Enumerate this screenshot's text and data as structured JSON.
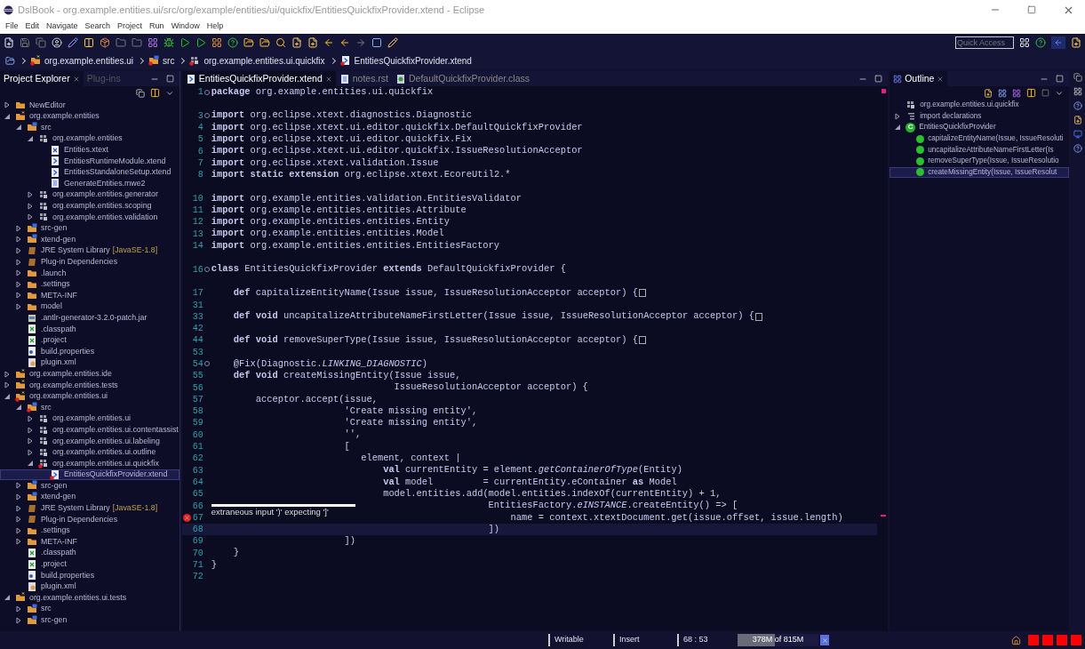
{
  "window": {
    "title": "DslBook - org.example.entities.ui/src/org/example/entities/ui/quickfix/EntitiesQuickfixProvider.xtend - Eclipse"
  },
  "menu": [
    "File",
    "Edit",
    "Navigate",
    "Search",
    "Project",
    "Run",
    "Window",
    "Help"
  ],
  "quick_access": {
    "placeholder": "Quick Access"
  },
  "breadcrumb": [
    {
      "label": "org.example.entities.ui",
      "kind": "project"
    },
    {
      "label": "src",
      "kind": "source-folder"
    },
    {
      "label": "org.example.entities.ui.quickfix",
      "kind": "package"
    },
    {
      "label": "EntitiesQuickfixProvider.xtend",
      "kind": "xtend-file"
    }
  ],
  "left_panel": {
    "tabs": [
      {
        "label": "Project Explorer",
        "selected": true
      },
      {
        "label": "Plug-ins",
        "selected": false
      }
    ],
    "tree": [
      {
        "label": "NewEditor",
        "kind": "folder",
        "expanded": false,
        "selected": false
      },
      {
        "label": "org.example.entities",
        "kind": "project",
        "expanded": true,
        "selected": false,
        "children": [
          {
            "label": "src",
            "kind": "source-folder",
            "expanded": true,
            "selected": false,
            "children": [
              {
                "label": "org.example.entities",
                "kind": "package",
                "expanded": true,
                "selected": false,
                "children": [
                  {
                    "label": "Entities.xtext",
                    "kind": "xtext-file",
                    "selected": false
                  },
                  {
                    "label": "EntitiesRuntimeModule.xtend",
                    "kind": "xtend-file",
                    "selected": false
                  },
                  {
                    "label": "EntitiesStandaloneSetup.xtend",
                    "kind": "xtend-file",
                    "selected": false
                  },
                  {
                    "label": "GenerateEntities.mwe2",
                    "kind": "text-file",
                    "selected": false
                  }
                ]
              },
              {
                "label": "org.example.entities.generator",
                "kind": "package",
                "expanded": false,
                "selected": false
              },
              {
                "label": "org.example.entities.scoping",
                "kind": "package",
                "expanded": false,
                "selected": false
              },
              {
                "label": "org.example.entities.validation",
                "kind": "package",
                "expanded": false,
                "selected": false
              }
            ]
          },
          {
            "label": "src-gen",
            "kind": "source-folder",
            "expanded": false,
            "selected": false
          },
          {
            "label": "xtend-gen",
            "kind": "source-folder",
            "expanded": false,
            "selected": false
          },
          {
            "label": "JRE System Library",
            "decoration": "[JavaSE-1.8]",
            "kind": "library",
            "expanded": false,
            "selected": false
          },
          {
            "label": "Plug-in Dependencies",
            "kind": "library",
            "expanded": false,
            "selected": false
          },
          {
            "label": ".launch",
            "kind": "folder",
            "expanded": false,
            "selected": false
          },
          {
            "label": ".settings",
            "kind": "folder",
            "expanded": false,
            "selected": false
          },
          {
            "label": "META-INF",
            "kind": "folder",
            "expanded": false,
            "selected": false
          },
          {
            "label": "model",
            "kind": "folder",
            "expanded": false,
            "selected": false
          },
          {
            "label": ".antlr-generator-3.2.0-patch.jar",
            "kind": "jar",
            "selected": false
          },
          {
            "label": ".classpath",
            "kind": "xml-file",
            "selected": false
          },
          {
            "label": ".project",
            "kind": "xml-file",
            "selected": false
          },
          {
            "label": "build.properties",
            "kind": "properties-file",
            "selected": false
          },
          {
            "label": "plugin.xml",
            "kind": "plugin-file",
            "selected": false
          }
        ]
      },
      {
        "label": "org.example.entities.ide",
        "kind": "project",
        "expanded": false,
        "selected": false
      },
      {
        "label": "org.example.entities.tests",
        "kind": "project",
        "expanded": false,
        "selected": false
      },
      {
        "label": "org.example.entities.ui",
        "kind": "project",
        "error": true,
        "expanded": true,
        "selected": false,
        "children": [
          {
            "label": "src",
            "kind": "source-folder",
            "error": true,
            "expanded": true,
            "selected": false,
            "children": [
              {
                "label": "org.example.entities.ui",
                "kind": "package",
                "expanded": false,
                "selected": false
              },
              {
                "label": "org.example.entities.ui.contentassist",
                "kind": "package",
                "expanded": false,
                "selected": false
              },
              {
                "label": "org.example.entities.ui.labeling",
                "kind": "package",
                "expanded": false,
                "selected": false
              },
              {
                "label": "org.example.entities.ui.outline",
                "kind": "package",
                "expanded": false,
                "selected": false
              },
              {
                "label": "org.example.entities.ui.quickfix",
                "kind": "package",
                "error": true,
                "expanded": true,
                "selected": false,
                "children": [
                  {
                    "label": "EntitiesQuickfixProvider.xtend",
                    "kind": "xtend-file",
                    "error": true,
                    "selected": true
                  }
                ]
              }
            ]
          },
          {
            "label": "src-gen",
            "kind": "source-folder",
            "expanded": false,
            "selected": false
          },
          {
            "label": "xtend-gen",
            "kind": "source-folder",
            "expanded": false,
            "selected": false
          },
          {
            "label": "JRE System Library",
            "decoration": "[JavaSE-1.8]",
            "kind": "library",
            "expanded": false,
            "selected": false
          },
          {
            "label": "Plug-in Dependencies",
            "kind": "library",
            "expanded": false,
            "selected": false
          },
          {
            "label": ".settings",
            "kind": "folder",
            "expanded": false,
            "selected": false
          },
          {
            "label": "META-INF",
            "kind": "folder",
            "expanded": false,
            "selected": false
          },
          {
            "label": ".classpath",
            "kind": "xml-file",
            "selected": false
          },
          {
            "label": ".project",
            "kind": "xml-file",
            "selected": false
          },
          {
            "label": "build.properties",
            "kind": "properties-file",
            "selected": false
          },
          {
            "label": "plugin.xml",
            "kind": "plugin-file",
            "selected": false
          }
        ]
      },
      {
        "label": "org.example.entities.ui.tests",
        "kind": "project",
        "expanded": true,
        "selected": false,
        "children": [
          {
            "label": "src",
            "kind": "source-folder",
            "expanded": false,
            "selected": false
          },
          {
            "label": "src-gen",
            "kind": "source-folder",
            "expanded": false,
            "selected": false
          }
        ]
      }
    ]
  },
  "editor": {
    "tabs": [
      {
        "label": "EntitiesQuickfixProvider.xtend",
        "kind": "xtend-file",
        "selected": true
      },
      {
        "label": "notes.rst",
        "kind": "text-file",
        "selected": false
      },
      {
        "label": "DefaultQuickfixProvider.class",
        "kind": "class-file",
        "selected": false
      }
    ],
    "lines": [
      {
        "number": "1",
        "text": "**package** org.example.entities.ui.quickfix",
        "fold_toggle": true,
        "current": false
      },
      {
        "current": false
      },
      {
        "number": "3",
        "text": "**import** org.eclipse.xtext.diagnostics.Diagnostic",
        "fold_toggle": true,
        "current": false
      },
      {
        "number": "4",
        "text": "**import** org.eclipse.xtext.ui.editor.quickfix.DefaultQuickfixProvider",
        "current": false
      },
      {
        "number": "5",
        "text": "**import** org.eclipse.xtext.ui.editor.quickfix.Fix",
        "current": false
      },
      {
        "number": "6",
        "text": "**import** org.eclipse.xtext.ui.editor.quickfix.IssueResolutionAcceptor",
        "current": false
      },
      {
        "number": "7",
        "text": "**import** org.eclipse.xtext.validation.Issue",
        "current": false
      },
      {
        "number": "8",
        "text": "**import** **static** **extension** org.eclipse.xtext.EcoreUtil2.*",
        "current": false
      },
      {
        "current": false
      },
      {
        "number": "10",
        "text": "**import** org.example.entities.validation.EntitiesValidator",
        "current": false
      },
      {
        "number": "11",
        "text": "**import** org.example.entities.entities.Attribute",
        "current": false
      },
      {
        "number": "12",
        "text": "**import** org.example.entities.entities.Entity",
        "current": false
      },
      {
        "number": "13",
        "text": "**import** org.example.entities.entities.Model",
        "current": false
      },
      {
        "number": "14",
        "text": "**import** org.example.entities.entities.EntitiesFactory",
        "current": false
      },
      {
        "current": false
      },
      {
        "number": "16",
        "text": "**class** EntitiesQuickfixProvider **extends** DefaultQuickfixProvider {",
        "fold_toggle": true,
        "current": false
      },
      {
        "current": false
      },
      {
        "number": "17",
        "text": "    **def** capitalizeEntityName(Issue issue, IssueResolutionAcceptor acceptor) {",
        "collapsed": true,
        "current": false
      },
      {
        "number": "31",
        "current": false
      },
      {
        "number": "33",
        "text": "    **def** **void** uncapitalizeAttributeNameFirstLetter(Issue issue, IssueResolutionAcceptor acceptor) {",
        "collapsed": true,
        "current": false
      },
      {
        "number": "42",
        "current": false
      },
      {
        "number": "44",
        "text": "    **def** **void** removeSuperType(Issue issue, IssueResolutionAcceptor acceptor) {",
        "collapsed": true,
        "current": false
      },
      {
        "number": "53",
        "current": false
      },
      {
        "number": "54",
        "text": "    @Fix(Diagnostic.*LINKING_DIAGNOSTIC*)",
        "fold_toggle": true,
        "current": false
      },
      {
        "number": "55",
        "text": "    **def** **void** createMissingEntity(Issue issue,",
        "current": false
      },
      {
        "number": "56",
        "text": "                                 IssueResolutionAcceptor acceptor) {",
        "current": false
      },
      {
        "number": "57",
        "text": "        acceptor.accept(issue,",
        "current": false
      },
      {
        "number": "58",
        "text": "                        'Create missing entity',",
        "current": false
      },
      {
        "number": "59",
        "text": "                        'Create missing entity',",
        "current": false
      },
      {
        "number": "60",
        "text": "                        '',",
        "current": false
      },
      {
        "number": "61",
        "text": "                        [",
        "current": false
      },
      {
        "number": "62",
        "text": "                           element, context |",
        "current": false
      },
      {
        "number": "63",
        "text": "                               **val** currentEntity = element.*getContainerOfType*(Entity)",
        "current": false
      },
      {
        "number": "64",
        "text": "                               **val** model         = currentEntity.eContainer **as** Model",
        "current": false
      },
      {
        "number": "65",
        "text": "                               model.entities.add(model.entities.indexOf(currentEntity) + 1,",
        "current": false
      },
      {
        "number": "66",
        "text": "                                                  EntitiesFactory.*eINSTANCE*.createEntity() => [",
        "current": false
      },
      {
        "number": "67",
        "text": "                                                      name = context.xtextDocument.get(issue.offset, issue.length)",
        "error": true,
        "current": false
      },
      {
        "number": "68",
        "text": "                                                  ])",
        "current": true
      },
      {
        "number": "69",
        "text": "                        ])",
        "current": false
      },
      {
        "number": "70",
        "text": "    }",
        "current": false
      },
      {
        "number": "71",
        "text": "}",
        "current": false
      },
      {
        "number": "72",
        "current": false
      }
    ],
    "error_tooltip": "extraneous input ')' expecting ']'"
  },
  "outline": {
    "tab": "Outline",
    "tree": [
      {
        "label": "org.example.entities.ui.quickfix",
        "kind": "package",
        "selected": false
      },
      {
        "label": "import declarations",
        "kind": "imports",
        "expanded": false,
        "selected": false
      },
      {
        "label": "EntitiesQuickfixProvider",
        "kind": "class",
        "badge": "C",
        "expanded": true,
        "selected": false,
        "children": [
          {
            "label": "capitalizeEntityName(Issue, IssueResoluti",
            "kind": "method",
            "selected": false
          },
          {
            "label": "uncapitalizeAttributeNameFirstLetter(Is",
            "kind": "method",
            "selected": false
          },
          {
            "label": "removeSuperType(Issue, IssueResolutio",
            "kind": "method",
            "selected": false
          },
          {
            "label": "createMissingEntity(Issue, IssueResolut",
            "kind": "method",
            "selected": true
          }
        ]
      }
    ]
  },
  "status_bar": {
    "mode": "Writable",
    "insert": "Insert",
    "position": "68 : 53",
    "memory": {
      "text": "378M of 815M",
      "level": 0.46
    }
  }
}
